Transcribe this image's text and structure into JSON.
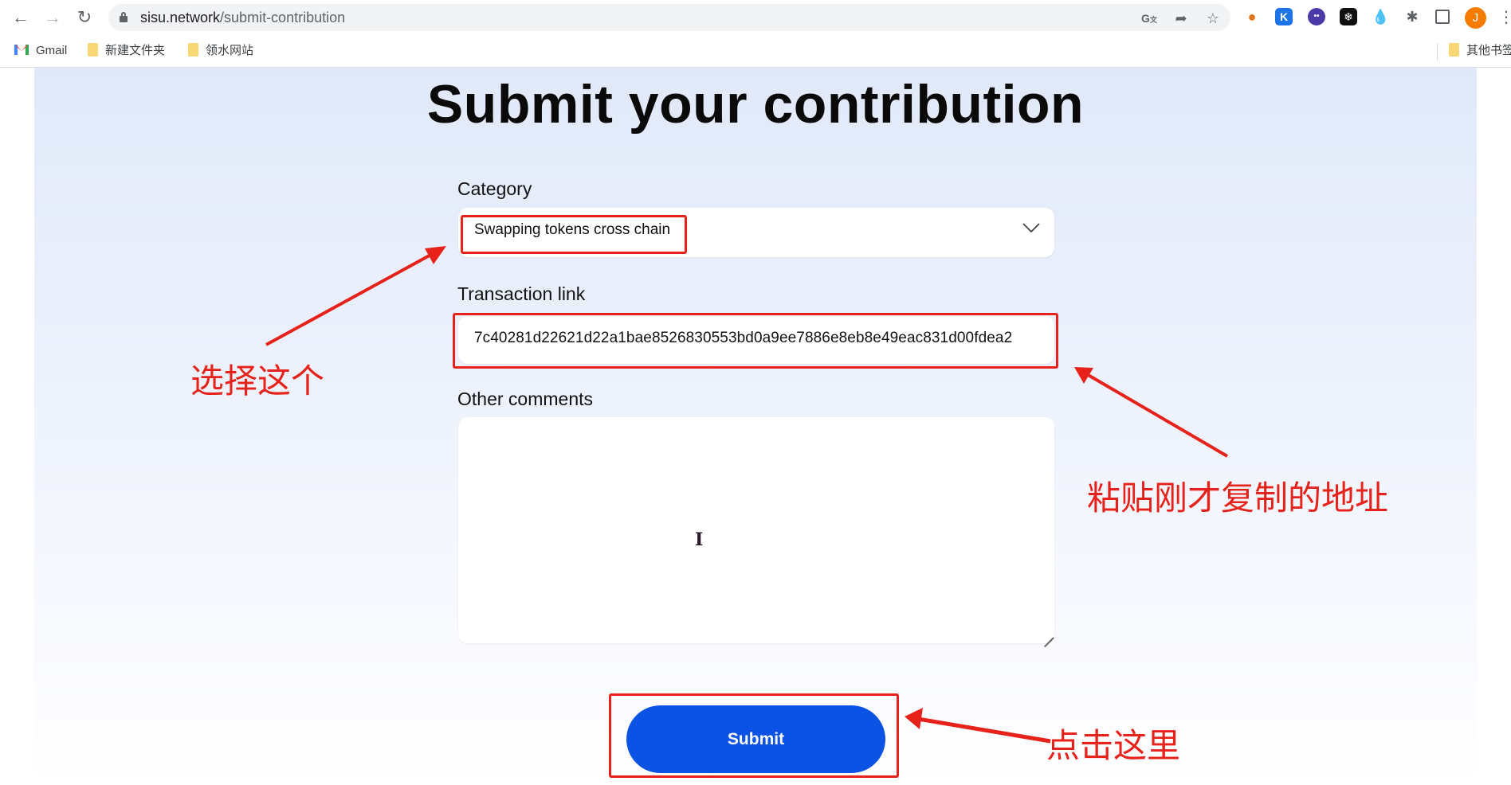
{
  "browser": {
    "url_host": "sisu.network",
    "url_path": "/submit-contribution",
    "nav": {
      "back_icon": "arrow-left",
      "forward_icon": "arrow-right",
      "reload_icon": "reload"
    },
    "omnibox_icons": [
      "translate-icon",
      "share-icon",
      "star-icon"
    ],
    "extensions": [
      {
        "name": "metamask",
        "glyph": "🦊",
        "color": "#ffffff"
      },
      {
        "name": "k-wallet",
        "glyph": "K",
        "color": "#1d74e8"
      },
      {
        "name": "ghost-wallet",
        "glyph": "•‿•",
        "color": "#4a3aa8"
      },
      {
        "name": "snowflake",
        "glyph": "❄",
        "color": "#111111"
      },
      {
        "name": "droplet",
        "glyph": "💧",
        "color": "#ffffff"
      }
    ],
    "avatar_initial": "J",
    "avatar_color": "#f57c00"
  },
  "bookmarks": {
    "items": [
      {
        "label": "Gmail",
        "icon": "gmail-icon"
      },
      {
        "label": "新建文件夹",
        "icon": "folder-icon"
      },
      {
        "label": "领水网站",
        "icon": "folder-icon"
      }
    ],
    "other": "其他书签"
  },
  "form": {
    "title": "Submit your contribution",
    "category": {
      "label": "Category",
      "selected": "Swapping tokens cross chain"
    },
    "transaction": {
      "label": "Transaction link",
      "value": "7c40281d22621d22a1bae8526830553bd0a9ee7886e8eb8e49eac831d00fdea2"
    },
    "comments": {
      "label": "Other comments",
      "value": ""
    },
    "submit_label": "Submit"
  },
  "annotations": {
    "select_this": "选择这个",
    "paste_address": "粘贴刚才复制的地址",
    "click_here": "点击这里",
    "color": "#e6221b"
  },
  "colors": {
    "primary_button": "#0a53e4",
    "panel_top": "#e1e9f9"
  }
}
